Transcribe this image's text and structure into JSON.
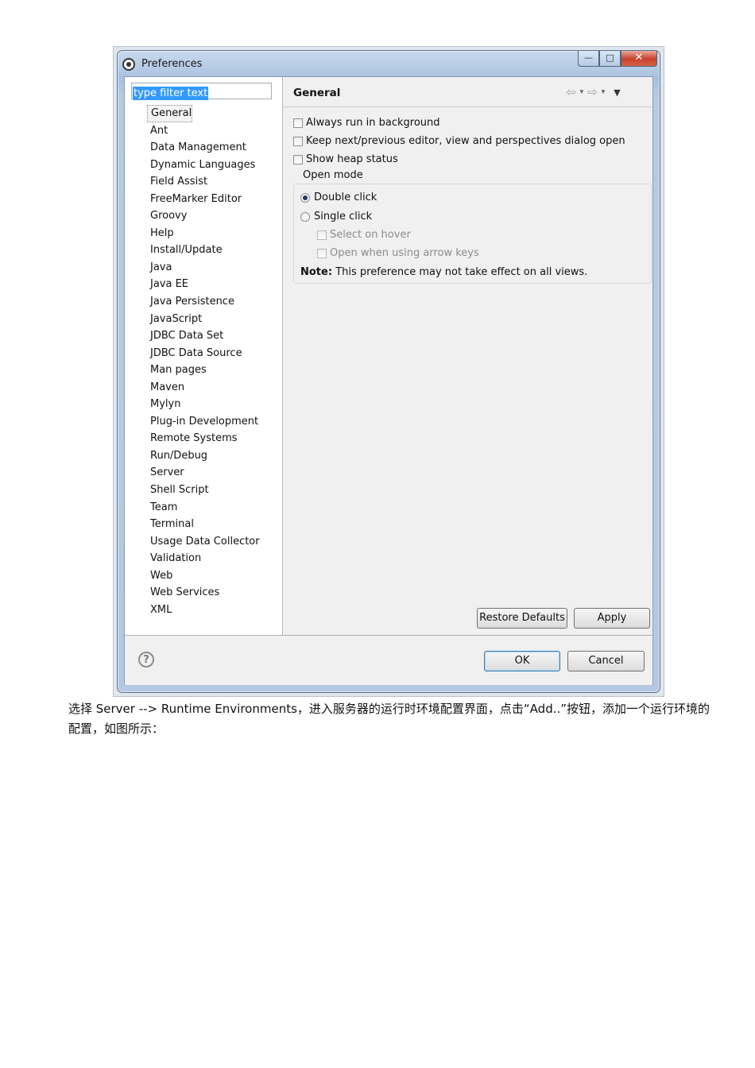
{
  "window": {
    "title": "Preferences",
    "minimize_glyph": "—",
    "maximize_glyph": "□",
    "close_glyph": "✕"
  },
  "filter": {
    "value": "type filter text"
  },
  "tree": {
    "items": [
      "General",
      "Ant",
      "Data Management",
      "Dynamic Languages",
      "Field Assist",
      "FreeMarker Editor",
      "Groovy",
      "Help",
      "Install/Update",
      "Java",
      "Java EE",
      "Java Persistence",
      "JavaScript",
      "JDBC Data Set",
      "JDBC Data Source",
      "Man pages",
      "Maven",
      "Mylyn",
      "Plug-in Development",
      "Remote Systems",
      "Run/Debug",
      "Server",
      "Shell Script",
      "Team",
      "Terminal",
      "Usage Data Collector",
      "Validation",
      "Web",
      "Web Services",
      "XML"
    ],
    "selected": "General"
  },
  "page": {
    "title": "General",
    "nav": {
      "back": "⇦",
      "forward": "⇨",
      "dropdown": "▾",
      "menu": "▼"
    },
    "options": {
      "always_run": "Always run in background",
      "keep_open": "Keep next/previous editor, view and perspectives dialog open",
      "show_heap": "Show heap status"
    },
    "open_mode": {
      "label": "Open mode",
      "double_click": "Double click",
      "single_click": "Single click",
      "select_on_hover": "Select on hover",
      "open_arrow_keys": "Open when using arrow keys",
      "selected": "Double click"
    },
    "note_label": "Note:",
    "note_text": "This preference may not take effect on all views.",
    "restore_defaults": "Restore Defaults",
    "apply": "Apply"
  },
  "footer": {
    "help_glyph": "?",
    "ok": "OK",
    "cancel": "Cancel"
  },
  "caption": "选择 Server --> Runtime Environments，进入服务器的运行时环境配置界面，点击“Add..”按钮，添加一个运行环境的配置，如图所示："
}
